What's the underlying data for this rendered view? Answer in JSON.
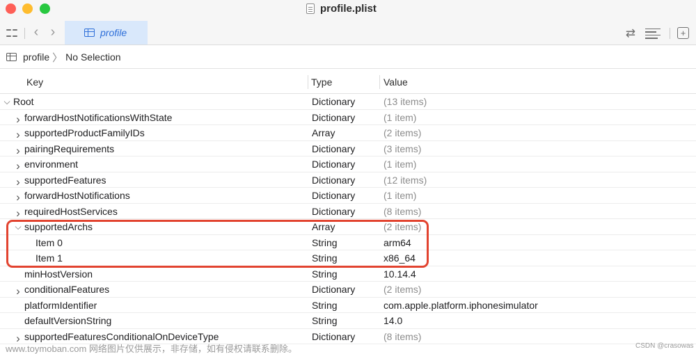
{
  "window": {
    "title": "profile.plist"
  },
  "toolbar": {
    "active_tab": "profile"
  },
  "breadcrumb": {
    "root": "profile",
    "selection": "No Selection"
  },
  "columns": {
    "key": "Key",
    "type": "Type",
    "value": "Value"
  },
  "rows": [
    {
      "key": "Root",
      "type": "Dictionary",
      "value": "(13 items)",
      "depth": 0,
      "expander": "expanded",
      "value_muted": true
    },
    {
      "key": "forwardHostNotificationsWithState",
      "type": "Dictionary",
      "value": "(1 item)",
      "depth": 1,
      "expander": "collapsed",
      "value_muted": true
    },
    {
      "key": "supportedProductFamilyIDs",
      "type": "Array",
      "value": "(2 items)",
      "depth": 1,
      "expander": "collapsed",
      "value_muted": true
    },
    {
      "key": "pairingRequirements",
      "type": "Dictionary",
      "value": "(3 items)",
      "depth": 1,
      "expander": "collapsed",
      "value_muted": true
    },
    {
      "key": "environment",
      "type": "Dictionary",
      "value": "(1 item)",
      "depth": 1,
      "expander": "collapsed",
      "value_muted": true
    },
    {
      "key": "supportedFeatures",
      "type": "Dictionary",
      "value": "(12 items)",
      "depth": 1,
      "expander": "collapsed",
      "value_muted": true
    },
    {
      "key": "forwardHostNotifications",
      "type": "Dictionary",
      "value": "(1 item)",
      "depth": 1,
      "expander": "collapsed",
      "value_muted": true
    },
    {
      "key": "requiredHostServices",
      "type": "Dictionary",
      "value": "(8 items)",
      "depth": 1,
      "expander": "collapsed",
      "value_muted": true
    },
    {
      "key": "supportedArchs",
      "type": "Array",
      "value": "(2 items)",
      "depth": 1,
      "expander": "expanded",
      "value_muted": true
    },
    {
      "key": "Item 0",
      "type": "String",
      "value": "arm64",
      "depth": 2,
      "expander": "none",
      "value_muted": false
    },
    {
      "key": "Item 1",
      "type": "String",
      "value": "x86_64",
      "depth": 2,
      "expander": "none",
      "value_muted": false
    },
    {
      "key": "minHostVersion",
      "type": "String",
      "value": "10.14.4",
      "depth": 1,
      "expander": "none",
      "value_muted": false
    },
    {
      "key": "conditionalFeatures",
      "type": "Dictionary",
      "value": "(2 items)",
      "depth": 1,
      "expander": "collapsed",
      "value_muted": true
    },
    {
      "key": "platformIdentifier",
      "type": "String",
      "value": "com.apple.platform.iphonesimulator",
      "depth": 1,
      "expander": "none",
      "value_muted": false
    },
    {
      "key": "defaultVersionString",
      "type": "String",
      "value": "14.0",
      "depth": 1,
      "expander": "none",
      "value_muted": false
    },
    {
      "key": "supportedFeaturesConditionalOnDeviceType",
      "type": "Dictionary",
      "value": "(8 items)",
      "depth": 1,
      "expander": "collapsed",
      "value_muted": true
    }
  ],
  "watermark": {
    "left": "www.toymoban.com 网络图片仅供展示，非存储，如有侵权请联系删除。",
    "right": "CSDN @crasowas"
  },
  "colors": {
    "accent": "#2e6fd9",
    "highlight": "#e2432f",
    "active_tab_bg": "#d9e8fb"
  },
  "icons": {
    "traffic": [
      "close-dot",
      "minimize-dot",
      "zoom-dot"
    ],
    "toolbar": [
      "grid-icon",
      "chevron-left-icon",
      "chevron-right-icon",
      "table-icon",
      "swap-arrows-icon",
      "text-lines-icon",
      "add-item-icon"
    ]
  }
}
